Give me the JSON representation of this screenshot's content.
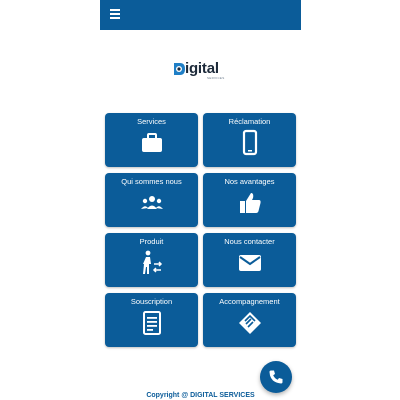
{
  "colors": {
    "primary": "#0b5c99",
    "background": "#ffffff",
    "text_on_primary": "#ffffff"
  },
  "header": {
    "menu_icon": "hamburger-menu-icon"
  },
  "logo": {
    "word": "igital",
    "sub": "SERVICES"
  },
  "tiles": [
    {
      "label": "Services",
      "icon": "briefcase-icon"
    },
    {
      "label": "Réclamation",
      "icon": "smartphone-icon"
    },
    {
      "label": "Qui sommes nous",
      "icon": "group-icon"
    },
    {
      "label": "Nos avantages",
      "icon": "thumbs-up-icon"
    },
    {
      "label": "Produit",
      "icon": "person-transfer-icon"
    },
    {
      "label": "Nous contacter",
      "icon": "envelope-icon"
    },
    {
      "label": "Souscription",
      "icon": "document-icon"
    },
    {
      "label": "Accompagnement",
      "icon": "handshake-icon"
    }
  ],
  "fab": {
    "icon": "phone-icon"
  },
  "footer": {
    "text": "Copyright @ DIGITAL SERVICES"
  }
}
